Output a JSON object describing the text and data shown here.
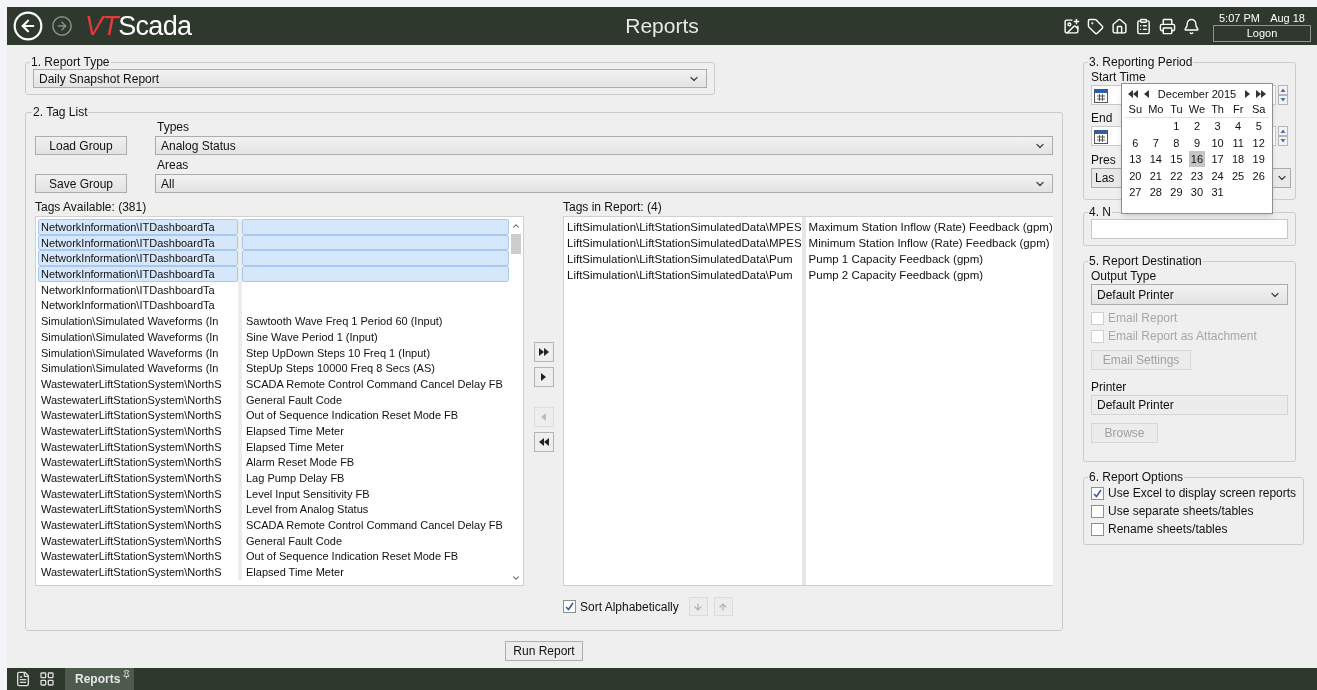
{
  "header": {
    "logo": {
      "first": "VT",
      "rest": "Scada"
    },
    "title": "Reports",
    "clock": {
      "time": "5:07 PM",
      "date": "Aug 18"
    },
    "logon_button": "Logon"
  },
  "report_type": {
    "legend": "1. Report Type",
    "value": "Daily Snapshot Report"
  },
  "tag_list": {
    "legend": "2. Tag List",
    "load_button": "Load Group",
    "save_button": "Save Group",
    "types": {
      "label": "Types",
      "value": "Analog Status"
    },
    "areas": {
      "label": "Areas",
      "value": "All"
    },
    "available": {
      "label": "Tags Available: (381)",
      "rows": [
        {
          "path": "NetworkInformation\\ITDashboardTa",
          "selected": true
        },
        {
          "path": "NetworkInformation\\ITDashboardTa",
          "selected": true
        },
        {
          "path": "NetworkInformation\\ITDashboardTa",
          "selected": true
        },
        {
          "path": "NetworkInformation\\ITDashboardTa",
          "selected": true
        },
        {
          "path": "NetworkInformation\\ITDashboardTa",
          "selected": false
        },
        {
          "path": "NetworkInformation\\ITDashboardTa",
          "selected": false
        },
        {
          "path": "Simulation\\Simulated Waveforms (In",
          "description": "Sawtooth Wave Freq 1 Period 60 (Input)",
          "selected": false
        },
        {
          "path": "Simulation\\Simulated Waveforms (In",
          "description": "Sine Wave Period 1 (Input)",
          "selected": false
        },
        {
          "path": "Simulation\\Simulated Waveforms (In",
          "description": "Step UpDown Steps 10 Freq 1 (Input)",
          "selected": false
        },
        {
          "path": "Simulation\\Simulated Waveforms (In",
          "description": "StepUp Steps 10000 Freq 8 Secs (AS)",
          "selected": false
        },
        {
          "path": "WastewaterLiftStationSystem\\NorthS",
          "description": "SCADA Remote Control Command Cancel Delay FB",
          "selected": false
        },
        {
          "path": "WastewaterLiftStationSystem\\NorthS",
          "description": "General Fault Code",
          "selected": false
        },
        {
          "path": "WastewaterLiftStationSystem\\NorthS",
          "description": "Out of Sequence Indication Reset Mode FB",
          "selected": false
        },
        {
          "path": "WastewaterLiftStationSystem\\NorthS",
          "description": "Elapsed Time Meter",
          "selected": false
        },
        {
          "path": "WastewaterLiftStationSystem\\NorthS",
          "description": "Elapsed Time Meter",
          "selected": false
        },
        {
          "path": "WastewaterLiftStationSystem\\NorthS",
          "description": "Alarm Reset Mode FB",
          "selected": false
        },
        {
          "path": "WastewaterLiftStationSystem\\NorthS",
          "description": "Lag Pump Delay FB",
          "selected": false
        },
        {
          "path": "WastewaterLiftStationSystem\\NorthS",
          "description": "Level Input Sensitivity FB",
          "selected": false
        },
        {
          "path": "WastewaterLiftStationSystem\\NorthS",
          "description": "Level from Analog Status",
          "selected": false
        },
        {
          "path": "WastewaterLiftStationSystem\\NorthS",
          "description": "SCADA Remote Control Command Cancel Delay FB",
          "selected": false
        },
        {
          "path": "WastewaterLiftStationSystem\\NorthS",
          "description": "General Fault Code",
          "selected": false
        },
        {
          "path": "WastewaterLiftStationSystem\\NorthS",
          "description": "Out of Sequence Indication Reset Mode FB",
          "selected": false
        },
        {
          "path": "WastewaterLiftStationSystem\\NorthS",
          "description": "Elapsed Time Meter",
          "selected": false
        }
      ]
    },
    "transfer_buttons": [
      {
        "kind": "add_all",
        "disabled": false
      },
      {
        "kind": "add",
        "disabled": false
      },
      {
        "kind": "remove",
        "disabled": true
      },
      {
        "kind": "remove_all",
        "disabled": false
      }
    ],
    "in_report": {
      "label": "Tags in Report: (4)",
      "rows": [
        {
          "path": "LiftSimulation\\LiftStationSimulatedData\\MPES",
          "description": "Maximum Station Inflow (Rate) Feedback (gpm)"
        },
        {
          "path": "LiftSimulation\\LiftStationSimulatedData\\MPES",
          "description": "Minimum Station Inflow (Rate) Feedback (gpm)"
        },
        {
          "path": "LiftSimulation\\LiftStationSimulatedData\\Pum",
          "description": "Pump 1 Capacity Feedback (gpm)"
        },
        {
          "path": "LiftSimulation\\LiftStationSimulatedData\\Pum",
          "description": "Pump 2 Capacity Feedback (gpm)"
        }
      ]
    },
    "sort": {
      "label": "Sort Alphabetically",
      "checked": true
    },
    "move_buttons": [
      {
        "kind": "down",
        "disabled": true
      },
      {
        "kind": "up",
        "disabled": true
      }
    ]
  },
  "run_button": "Run Report",
  "reporting_period": {
    "legend": "3. Reporting Period",
    "start_label": "Start Time",
    "end_label": "End",
    "preset_label": "Pres",
    "preset_value": "Las"
  },
  "calendar": {
    "month": "December 2015",
    "weekdays": [
      "Su",
      "Mo",
      "Tu",
      "We",
      "Th",
      "Fr",
      "Sa"
    ],
    "weeks": [
      [
        {
          "day": "1",
          "selected": false
        },
        {
          "day": "2",
          "selected": false
        },
        {
          "day": "3",
          "selected": false
        },
        {
          "day": "4",
          "selected": false
        },
        {
          "day": "5",
          "selected": false
        }
      ],
      [
        {
          "day": "6",
          "selected": false
        },
        {
          "day": "7",
          "selected": false
        },
        {
          "day": "8",
          "selected": false
        },
        {
          "day": "9",
          "selected": false
        },
        {
          "day": "10",
          "selected": false
        },
        {
          "day": "11",
          "selected": false
        },
        {
          "day": "12",
          "selected": false
        }
      ],
      [
        {
          "day": "13",
          "selected": false
        },
        {
          "day": "14",
          "selected": false
        },
        {
          "day": "15",
          "selected": false
        },
        {
          "day": "16",
          "selected": true
        },
        {
          "day": "17",
          "selected": false
        },
        {
          "day": "18",
          "selected": false
        },
        {
          "day": "19",
          "selected": false
        }
      ],
      [
        {
          "day": "20",
          "selected": false
        },
        {
          "day": "21",
          "selected": false
        },
        {
          "day": "22",
          "selected": false
        },
        {
          "day": "23",
          "selected": false
        },
        {
          "day": "24",
          "selected": false
        },
        {
          "day": "25",
          "selected": false
        },
        {
          "day": "26",
          "selected": false
        }
      ],
      [
        {
          "day": "27",
          "selected": false
        },
        {
          "day": "28",
          "selected": false
        },
        {
          "day": "29",
          "selected": false
        },
        {
          "day": "30",
          "selected": false
        },
        {
          "day": "31",
          "selected": false
        }
      ]
    ]
  },
  "name_section": {
    "legend": "4. N"
  },
  "destination": {
    "legend": "5. Report Destination",
    "output_label": "Output Type",
    "output_value": "Default Printer",
    "checkboxes": [
      {
        "label": "Email Report",
        "checked": false,
        "disabled": true
      },
      {
        "label": "Email Report as Attachment",
        "checked": false,
        "disabled": true
      }
    ],
    "settings_button": {
      "label": "Email Settings",
      "disabled": true
    },
    "printer_label": "Printer",
    "printer_value": "Default Printer",
    "browse_button": {
      "label": "Browse",
      "disabled": true
    }
  },
  "options": {
    "legend": "6. Report Options",
    "checkboxes": [
      {
        "label": "Use Excel to display screen reports",
        "checked": true
      },
      {
        "label": "Use separate sheets/tables",
        "checked": false
      },
      {
        "label": "Rename sheets/tables",
        "checked": false
      }
    ]
  },
  "taskbar": {
    "tab": "Reports"
  }
}
